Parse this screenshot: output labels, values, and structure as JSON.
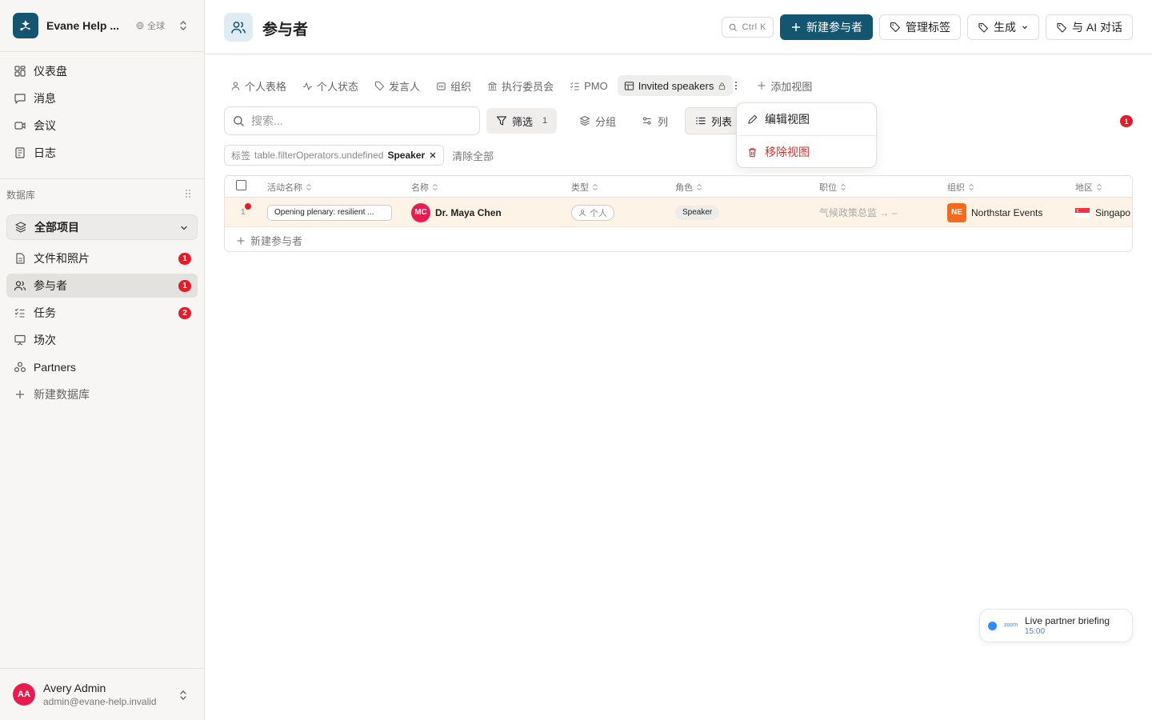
{
  "workspace": {
    "name": "Evane Help ...",
    "scope": "全球"
  },
  "nav": [
    {
      "label": "仪表盘",
      "icon": "dashboard-icon"
    },
    {
      "label": "消息",
      "icon": "message-icon"
    },
    {
      "label": "会议",
      "icon": "video-icon"
    },
    {
      "label": "日志",
      "icon": "log-icon"
    }
  ],
  "database": {
    "section_label": "数据库",
    "selector": "全部项目",
    "items": [
      {
        "label": "文件和照片",
        "badge": "1"
      },
      {
        "label": "参与者",
        "badge": "1",
        "active": true
      },
      {
        "label": "任务",
        "badge": "2"
      },
      {
        "label": "场次",
        "badge": ""
      },
      {
        "label": "Partners",
        "badge": ""
      }
    ],
    "new_label": "新建数据库"
  },
  "user": {
    "initials": "AA",
    "name": "Avery Admin",
    "email": "admin@evane-help.invalid"
  },
  "header": {
    "title": "参与者",
    "shortcut": "Ctrl K",
    "new_button": "新建参与者",
    "manage_tags": "管理标签",
    "generate": "生成",
    "ai_chat": "与 AI 对话"
  },
  "tabs": [
    "个人表格",
    "个人状态",
    "发言人",
    "组织",
    "执行委员会",
    "PMO",
    "Invited speakers",
    "添加视图"
  ],
  "toolbar": {
    "search_placeholder": "搜索...",
    "filter": "筛选",
    "filter_count": "1",
    "group": "分组",
    "columns": "列",
    "list": "列表",
    "badge": "1"
  },
  "filter_chip": {
    "field": "标签",
    "operator": "table.filterOperators.undefined",
    "value": "Speaker",
    "clear_all": "清除全部"
  },
  "table": {
    "columns": [
      "活动名称",
      "名称",
      "类型",
      "角色",
      "职位",
      "组织",
      "地区"
    ],
    "rows": [
      {
        "index": "1",
        "event": "Opening plenary: resilient ...",
        "avatar": "MC",
        "name": "Dr. Maya Chen",
        "type": "个人",
        "role": "Speaker",
        "position": "气候政策总监 → –",
        "org_logo": "NE",
        "org": "Northstar Events",
        "region": "Singapo"
      }
    ],
    "new_row": "新建参与者"
  },
  "context_menu": {
    "edit": "编辑视图",
    "remove": "移除视图"
  },
  "toast": {
    "brand": "zoom",
    "title": "Live partner briefing",
    "time": "15:00"
  },
  "colors": {
    "primary": "#14566f",
    "danger": "#e11d2a",
    "row_highlight": "#fdf3e6"
  }
}
